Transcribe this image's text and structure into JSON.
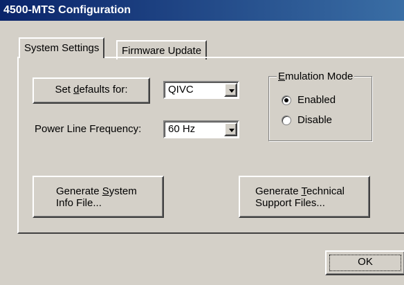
{
  "window": {
    "title": "4500-MTS Configuration"
  },
  "tabs": [
    {
      "label": "System Settings",
      "active": true
    },
    {
      "label": "Firmware Update",
      "active": false
    }
  ],
  "defaults": {
    "button_pre": "Set ",
    "button_mnemonic": "d",
    "button_post": "efaults for:",
    "selected": "QIVC"
  },
  "power": {
    "label": "Power Line Frequency:",
    "selected": "60 Hz"
  },
  "emulation": {
    "title_mnemonic": "E",
    "title_rest": "mulation Mode",
    "options": [
      {
        "label": "Enabled",
        "selected": true
      },
      {
        "label": "Disable",
        "selected": false
      }
    ]
  },
  "buttons": {
    "sysinfo_line1_pre": "Generate ",
    "sysinfo_line1_mnemonic": "S",
    "sysinfo_line1_post": "ystem",
    "sysinfo_line2": "Info File...",
    "support_line1_pre": "Generate ",
    "support_line1_mnemonic": "T",
    "support_line1_post": "echnical",
    "support_line2": "Support Files...",
    "ok": "OK"
  },
  "colors": {
    "titlebar_start": "#0a246a",
    "titlebar_end": "#3a6ea5",
    "face": "#d4d0c8"
  }
}
